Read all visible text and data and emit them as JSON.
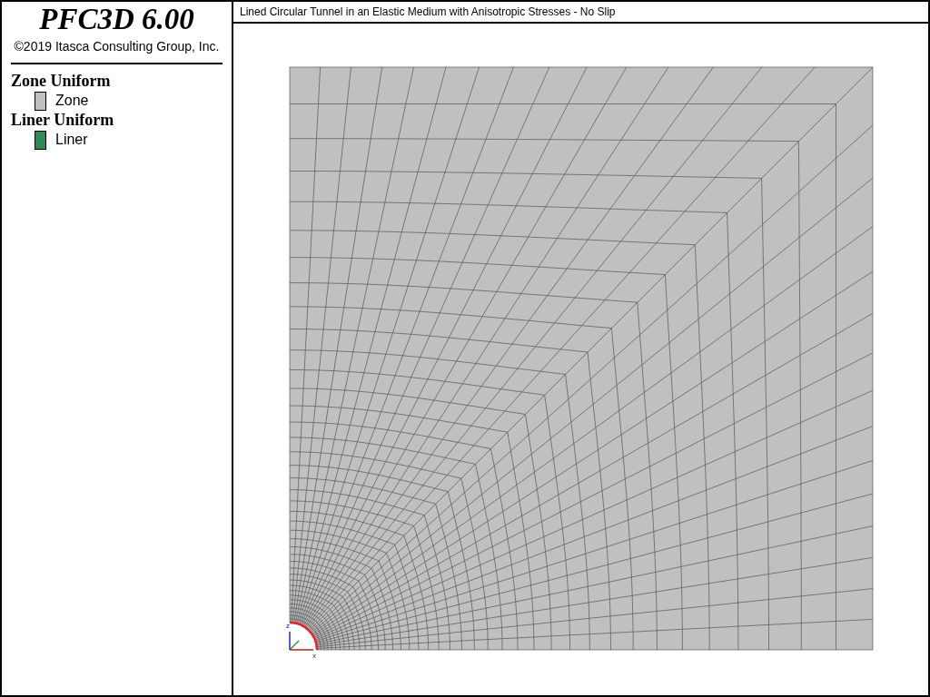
{
  "legend": {
    "product": "PFC3D 6.00",
    "copyright": "©2019 Itasca Consulting Group, Inc.",
    "groups": [
      {
        "title": "Zone Uniform",
        "items": [
          {
            "label": "Zone",
            "color": "#c0c0c0"
          }
        ]
      },
      {
        "title": "Liner Uniform",
        "items": [
          {
            "label": "Liner",
            "color": "#2e8b57"
          }
        ]
      }
    ]
  },
  "plot": {
    "title": "Lined Circular Tunnel in an Elastic Medium with Anisotropic Stresses - No Slip",
    "axes": {
      "vertical": "z",
      "horizontal": "x"
    }
  }
}
